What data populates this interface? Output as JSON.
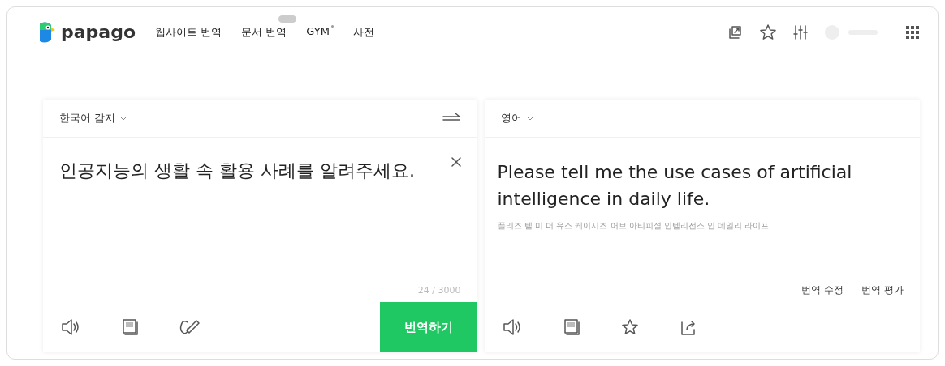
{
  "header": {
    "logo": "papago",
    "nav": [
      {
        "label": "웹사이트 번역",
        "badge": false,
        "dot": false
      },
      {
        "label": "문서 번역",
        "badge": true,
        "dot": false
      },
      {
        "label": "GYM",
        "badge": false,
        "dot": true
      },
      {
        "label": "사전",
        "badge": false,
        "dot": false
      }
    ],
    "tools": [
      {
        "kind": "external"
      },
      {
        "kind": "star"
      },
      {
        "kind": "sliders"
      },
      {
        "kind": "account"
      },
      {
        "kind": "apps"
      }
    ]
  },
  "source": {
    "language": "한국어 감지",
    "text": "인공지능의 생활 속 활용 사례를 알려주세요.",
    "count": "24 / 3000",
    "button": "번역하기",
    "tools": [
      {
        "kind": "speaker"
      },
      {
        "kind": "copy"
      },
      {
        "kind": "handwriting"
      }
    ]
  },
  "target": {
    "language": "영어",
    "text": "Please tell me the use cases of artificial intelligence in daily life.",
    "pronunciation": "플리즈 텔 미 더 유스 케이시즈 어브 아티피셜 인텔리전스 인 데일리 라이프",
    "actions": [
      "번역 수정",
      "번역 평가"
    ],
    "tools": [
      {
        "kind": "speaker"
      },
      {
        "kind": "copy"
      },
      {
        "kind": "star"
      },
      {
        "kind": "share"
      }
    ]
  }
}
